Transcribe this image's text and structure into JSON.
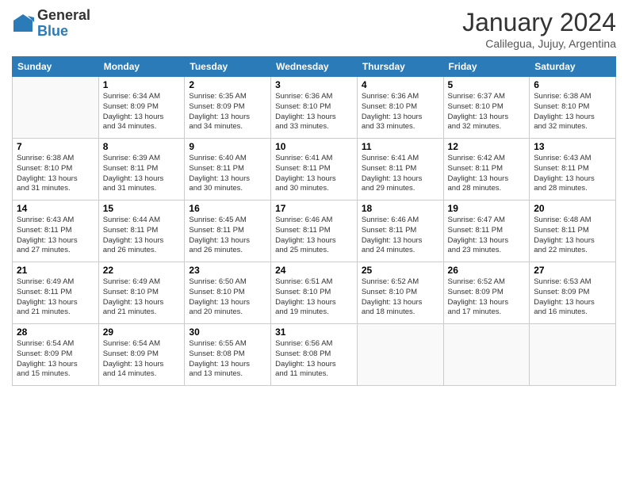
{
  "logo": {
    "general": "General",
    "blue": "Blue"
  },
  "header": {
    "month": "January 2024",
    "location": "Calilegua, Jujuy, Argentina"
  },
  "days_of_week": [
    "Sunday",
    "Monday",
    "Tuesday",
    "Wednesday",
    "Thursday",
    "Friday",
    "Saturday"
  ],
  "weeks": [
    [
      {
        "day": "",
        "info": ""
      },
      {
        "day": "1",
        "info": "Sunrise: 6:34 AM\nSunset: 8:09 PM\nDaylight: 13 hours\nand 34 minutes."
      },
      {
        "day": "2",
        "info": "Sunrise: 6:35 AM\nSunset: 8:09 PM\nDaylight: 13 hours\nand 34 minutes."
      },
      {
        "day": "3",
        "info": "Sunrise: 6:36 AM\nSunset: 8:10 PM\nDaylight: 13 hours\nand 33 minutes."
      },
      {
        "day": "4",
        "info": "Sunrise: 6:36 AM\nSunset: 8:10 PM\nDaylight: 13 hours\nand 33 minutes."
      },
      {
        "day": "5",
        "info": "Sunrise: 6:37 AM\nSunset: 8:10 PM\nDaylight: 13 hours\nand 32 minutes."
      },
      {
        "day": "6",
        "info": "Sunrise: 6:38 AM\nSunset: 8:10 PM\nDaylight: 13 hours\nand 32 minutes."
      }
    ],
    [
      {
        "day": "7",
        "info": "Sunrise: 6:38 AM\nSunset: 8:10 PM\nDaylight: 13 hours\nand 31 minutes."
      },
      {
        "day": "8",
        "info": "Sunrise: 6:39 AM\nSunset: 8:11 PM\nDaylight: 13 hours\nand 31 minutes."
      },
      {
        "day": "9",
        "info": "Sunrise: 6:40 AM\nSunset: 8:11 PM\nDaylight: 13 hours\nand 30 minutes."
      },
      {
        "day": "10",
        "info": "Sunrise: 6:41 AM\nSunset: 8:11 PM\nDaylight: 13 hours\nand 30 minutes."
      },
      {
        "day": "11",
        "info": "Sunrise: 6:41 AM\nSunset: 8:11 PM\nDaylight: 13 hours\nand 29 minutes."
      },
      {
        "day": "12",
        "info": "Sunrise: 6:42 AM\nSunset: 8:11 PM\nDaylight: 13 hours\nand 28 minutes."
      },
      {
        "day": "13",
        "info": "Sunrise: 6:43 AM\nSunset: 8:11 PM\nDaylight: 13 hours\nand 28 minutes."
      }
    ],
    [
      {
        "day": "14",
        "info": "Sunrise: 6:43 AM\nSunset: 8:11 PM\nDaylight: 13 hours\nand 27 minutes."
      },
      {
        "day": "15",
        "info": "Sunrise: 6:44 AM\nSunset: 8:11 PM\nDaylight: 13 hours\nand 26 minutes."
      },
      {
        "day": "16",
        "info": "Sunrise: 6:45 AM\nSunset: 8:11 PM\nDaylight: 13 hours\nand 26 minutes."
      },
      {
        "day": "17",
        "info": "Sunrise: 6:46 AM\nSunset: 8:11 PM\nDaylight: 13 hours\nand 25 minutes."
      },
      {
        "day": "18",
        "info": "Sunrise: 6:46 AM\nSunset: 8:11 PM\nDaylight: 13 hours\nand 24 minutes."
      },
      {
        "day": "19",
        "info": "Sunrise: 6:47 AM\nSunset: 8:11 PM\nDaylight: 13 hours\nand 23 minutes."
      },
      {
        "day": "20",
        "info": "Sunrise: 6:48 AM\nSunset: 8:11 PM\nDaylight: 13 hours\nand 22 minutes."
      }
    ],
    [
      {
        "day": "21",
        "info": "Sunrise: 6:49 AM\nSunset: 8:11 PM\nDaylight: 13 hours\nand 21 minutes."
      },
      {
        "day": "22",
        "info": "Sunrise: 6:49 AM\nSunset: 8:10 PM\nDaylight: 13 hours\nand 21 minutes."
      },
      {
        "day": "23",
        "info": "Sunrise: 6:50 AM\nSunset: 8:10 PM\nDaylight: 13 hours\nand 20 minutes."
      },
      {
        "day": "24",
        "info": "Sunrise: 6:51 AM\nSunset: 8:10 PM\nDaylight: 13 hours\nand 19 minutes."
      },
      {
        "day": "25",
        "info": "Sunrise: 6:52 AM\nSunset: 8:10 PM\nDaylight: 13 hours\nand 18 minutes."
      },
      {
        "day": "26",
        "info": "Sunrise: 6:52 AM\nSunset: 8:09 PM\nDaylight: 13 hours\nand 17 minutes."
      },
      {
        "day": "27",
        "info": "Sunrise: 6:53 AM\nSunset: 8:09 PM\nDaylight: 13 hours\nand 16 minutes."
      }
    ],
    [
      {
        "day": "28",
        "info": "Sunrise: 6:54 AM\nSunset: 8:09 PM\nDaylight: 13 hours\nand 15 minutes."
      },
      {
        "day": "29",
        "info": "Sunrise: 6:54 AM\nSunset: 8:09 PM\nDaylight: 13 hours\nand 14 minutes."
      },
      {
        "day": "30",
        "info": "Sunrise: 6:55 AM\nSunset: 8:08 PM\nDaylight: 13 hours\nand 13 minutes."
      },
      {
        "day": "31",
        "info": "Sunrise: 6:56 AM\nSunset: 8:08 PM\nDaylight: 13 hours\nand 11 minutes."
      },
      {
        "day": "",
        "info": ""
      },
      {
        "day": "",
        "info": ""
      },
      {
        "day": "",
        "info": ""
      }
    ]
  ]
}
